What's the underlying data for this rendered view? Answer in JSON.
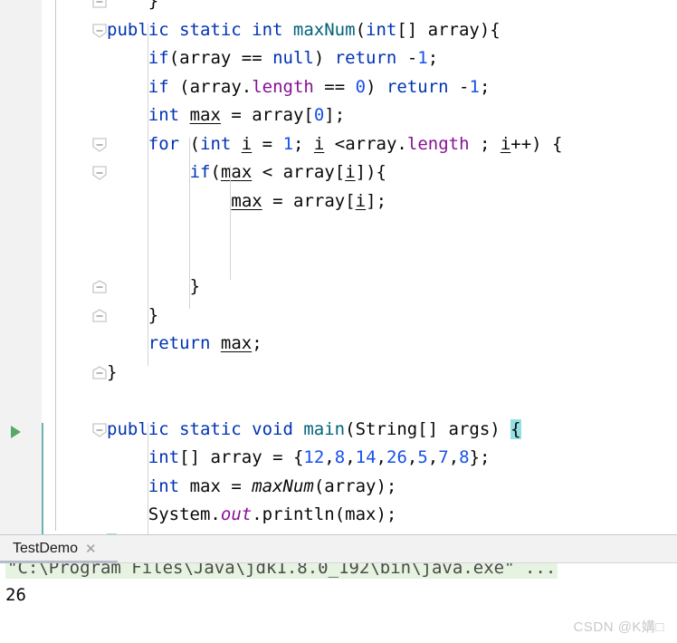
{
  "editor": {
    "lines": [
      {
        "indent": 0,
        "segments": [
          {
            "t": "    }",
            "c": "plain"
          }
        ]
      },
      {
        "indent": 0,
        "segments": [
          {
            "t": "public ",
            "c": "kw"
          },
          {
            "t": "static ",
            "c": "kw"
          },
          {
            "t": "int ",
            "c": "kw"
          },
          {
            "t": "maxNum",
            "c": "meth-decl"
          },
          {
            "t": "(",
            "c": "plain"
          },
          {
            "t": "int",
            "c": "kw"
          },
          {
            "t": "[] array){",
            "c": "plain"
          }
        ]
      },
      {
        "indent": 1,
        "segments": [
          {
            "t": "if",
            "c": "kw"
          },
          {
            "t": "(array == ",
            "c": "plain"
          },
          {
            "t": "null",
            "c": "kw"
          },
          {
            "t": ") ",
            "c": "plain"
          },
          {
            "t": "return ",
            "c": "kw"
          },
          {
            "t": "-",
            "c": "plain"
          },
          {
            "t": "1",
            "c": "num"
          },
          {
            "t": ";",
            "c": "plain"
          }
        ]
      },
      {
        "indent": 1,
        "segments": [
          {
            "t": "if",
            "c": "kw"
          },
          {
            "t": " (array.",
            "c": "plain"
          },
          {
            "t": "length",
            "c": "field"
          },
          {
            "t": " == ",
            "c": "plain"
          },
          {
            "t": "0",
            "c": "num"
          },
          {
            "t": ") ",
            "c": "plain"
          },
          {
            "t": "return ",
            "c": "kw"
          },
          {
            "t": "-",
            "c": "plain"
          },
          {
            "t": "1",
            "c": "num"
          },
          {
            "t": ";",
            "c": "plain"
          }
        ]
      },
      {
        "indent": 1,
        "segments": [
          {
            "t": "int ",
            "c": "kw"
          },
          {
            "t": "max",
            "c": "local"
          },
          {
            "t": " = array[",
            "c": "plain"
          },
          {
            "t": "0",
            "c": "num"
          },
          {
            "t": "];",
            "c": "plain"
          }
        ]
      },
      {
        "indent": 1,
        "segments": [
          {
            "t": "for ",
            "c": "kw"
          },
          {
            "t": "(",
            "c": "plain"
          },
          {
            "t": "int ",
            "c": "kw"
          },
          {
            "t": "i",
            "c": "local"
          },
          {
            "t": " = ",
            "c": "plain"
          },
          {
            "t": "1",
            "c": "num"
          },
          {
            "t": "; ",
            "c": "plain"
          },
          {
            "t": "i",
            "c": "local"
          },
          {
            "t": " <array.",
            "c": "plain"
          },
          {
            "t": "length",
            "c": "field"
          },
          {
            "t": " ; ",
            "c": "plain"
          },
          {
            "t": "i",
            "c": "local"
          },
          {
            "t": "++) {",
            "c": "plain"
          }
        ]
      },
      {
        "indent": 2,
        "segments": [
          {
            "t": "if",
            "c": "kw"
          },
          {
            "t": "(",
            "c": "plain"
          },
          {
            "t": "max",
            "c": "local"
          },
          {
            "t": " < array[",
            "c": "plain"
          },
          {
            "t": "i",
            "c": "local"
          },
          {
            "t": "]){",
            "c": "plain"
          }
        ]
      },
      {
        "indent": 3,
        "segments": [
          {
            "t": "max",
            "c": "local"
          },
          {
            "t": " = array[",
            "c": "plain"
          },
          {
            "t": "i",
            "c": "local"
          },
          {
            "t": "];",
            "c": "plain"
          }
        ]
      },
      {
        "indent": 0,
        "segments": []
      },
      {
        "indent": 0,
        "segments": []
      },
      {
        "indent": 2,
        "segments": [
          {
            "t": "}",
            "c": "plain"
          }
        ]
      },
      {
        "indent": 1,
        "segments": [
          {
            "t": "}",
            "c": "plain"
          }
        ]
      },
      {
        "indent": 1,
        "segments": [
          {
            "t": "return ",
            "c": "kw"
          },
          {
            "t": "max",
            "c": "local"
          },
          {
            "t": ";",
            "c": "plain"
          }
        ]
      },
      {
        "indent": 0,
        "segments": [
          {
            "t": "}",
            "c": "plain"
          }
        ]
      },
      {
        "indent": 0,
        "segments": []
      },
      {
        "indent": 0,
        "segments": [
          {
            "t": "public ",
            "c": "kw"
          },
          {
            "t": "static ",
            "c": "kw"
          },
          {
            "t": "void ",
            "c": "kw"
          },
          {
            "t": "main",
            "c": "meth-decl"
          },
          {
            "t": "(String[] args) ",
            "c": "plain"
          },
          {
            "t": "{",
            "c": "brace-hl"
          }
        ]
      },
      {
        "indent": 1,
        "segments": [
          {
            "t": "int",
            "c": "kw"
          },
          {
            "t": "[] array = {",
            "c": "plain"
          },
          {
            "t": "12",
            "c": "num"
          },
          {
            "t": ",",
            "c": "plain"
          },
          {
            "t": "8",
            "c": "num"
          },
          {
            "t": ",",
            "c": "plain"
          },
          {
            "t": "14",
            "c": "num"
          },
          {
            "t": ",",
            "c": "plain"
          },
          {
            "t": "26",
            "c": "num"
          },
          {
            "t": ",",
            "c": "plain"
          },
          {
            "t": "5",
            "c": "num"
          },
          {
            "t": ",",
            "c": "plain"
          },
          {
            "t": "7",
            "c": "num"
          },
          {
            "t": ",",
            "c": "plain"
          },
          {
            "t": "8",
            "c": "num"
          },
          {
            "t": "};",
            "c": "plain"
          }
        ]
      },
      {
        "indent": 1,
        "segments": [
          {
            "t": "int ",
            "c": "kw"
          },
          {
            "t": "max = ",
            "c": "plain"
          },
          {
            "t": "maxNum",
            "c": "static-meth"
          },
          {
            "t": "(array);",
            "c": "plain"
          }
        ]
      },
      {
        "indent": 1,
        "segments": [
          {
            "t": "System.",
            "c": "plain"
          },
          {
            "t": "out",
            "c": "static-field"
          },
          {
            "t": ".println(max);",
            "c": "plain"
          }
        ]
      },
      {
        "indent": 0,
        "segments": [
          {
            "t": "}",
            "c": "brace-hl"
          }
        ]
      }
    ],
    "run_arrow": "run-arrow-icon",
    "current_line_index": 19
  },
  "console": {
    "tab_label": "TestDemo",
    "close_icon": "✕",
    "command_line": "\"C:\\Program Files\\Java\\jdk1.8.0_192\\bin\\java.exe\" ...",
    "output": "26"
  },
  "watermark": {
    "text": "CSDN @K媾□"
  },
  "colors": {
    "keyword": "#0033b3",
    "number": "#1750eb",
    "method_declaration": "#00627a",
    "field": "#871094",
    "current_line_bg": "#fcfae2",
    "brace_highlight": "#93e0e3",
    "run_arrow": "#59a869",
    "console_cmd_bg": "#e6f3e0"
  }
}
